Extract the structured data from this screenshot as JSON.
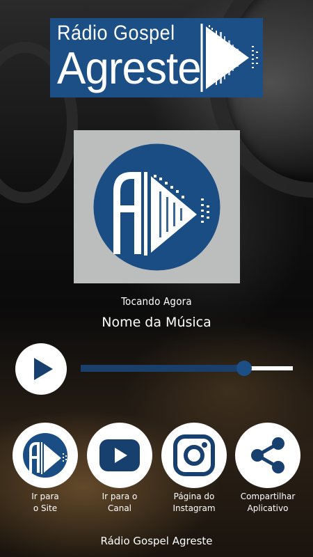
{
  "banner": {
    "line1": "Rádio Gospel",
    "line2": "Agreste"
  },
  "player": {
    "now_playing_label": "Tocando Agora",
    "song_title": "Nome da Música",
    "volume_fraction": 0.77
  },
  "actions": [
    {
      "line1": "Ir para",
      "line2": "o Site",
      "icon": "radio-logo-icon"
    },
    {
      "line1": "Ir para o",
      "line2": "Canal",
      "icon": "youtube-icon"
    },
    {
      "line1": "Página do",
      "line2": "Instagram",
      "icon": "instagram-icon"
    },
    {
      "line1": "Compartilhar",
      "line2": "Aplicativo",
      "icon": "share-icon"
    }
  ],
  "footer": {
    "text": "Rádio Gospel Agreste"
  },
  "colors": {
    "brand_blue": "#1c4f86",
    "dark_blue": "#17406e",
    "album_bg": "#bcbdbd"
  }
}
